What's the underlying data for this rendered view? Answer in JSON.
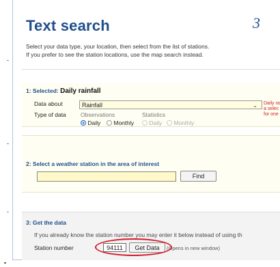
{
  "header": {
    "title": "Text search",
    "step_number": "3",
    "intro_line1": "Select your data type, your location, then select from the list of stations.",
    "intro_line2": "If you prefer to see the station locations, use the map search instead."
  },
  "section1": {
    "heading_prefix": "1: Selected:",
    "heading_value": "Daily rainfall",
    "data_about_label": "Data about",
    "data_about_value": "Rainfall",
    "type_label": "Type of data",
    "observations_label": "Observations",
    "statistics_label": "Statistics",
    "obs_daily": "Daily",
    "obs_monthly": "Monthly",
    "stat_daily": "Daily",
    "stat_monthly": "Monthly",
    "note_line1": "Daily ra",
    "note_line2": "a selec",
    "note_line3": "for one"
  },
  "section2": {
    "heading": "2:  Select a weather station in the area of interest",
    "search_value": "",
    "find_label": "Find"
  },
  "section3": {
    "heading": "3:   Get the data",
    "info_text": "If you already know the station number you may enter it below instead of using th",
    "station_label": "Station number",
    "station_value": "94111",
    "get_data_label": "Get Data",
    "opens_note": "(Opens in new window)"
  },
  "colors": {
    "title_blue": "#1f4e8c",
    "highlight_red": "#d21c2c",
    "note_red": "#cc2222"
  }
}
